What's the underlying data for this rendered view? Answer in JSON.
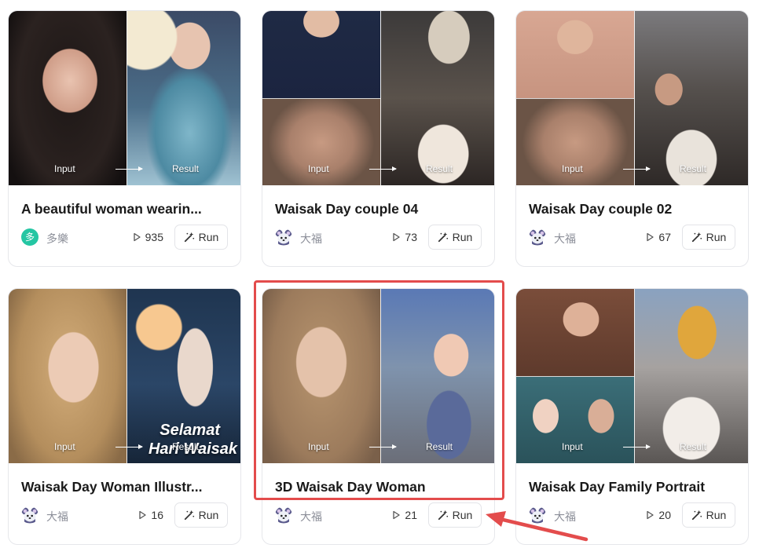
{
  "labels": {
    "input": "Input",
    "result": "Result",
    "run": "Run"
  },
  "colors": {
    "highlight": "#e34c4c",
    "avatar_green": "#24c6a3"
  },
  "cards": [
    {
      "title": "A beautiful woman wearin...",
      "author": "多樂",
      "avatar_text": "多",
      "runs": "935"
    },
    {
      "title": "Waisak Day couple 04",
      "author": "大福",
      "runs": "73"
    },
    {
      "title": "Waisak Day couple 02",
      "author": "大福",
      "runs": "67"
    },
    {
      "title": "Waisak Day Woman Illustr...",
      "author": "大福",
      "runs": "16",
      "overlay_line1": "Selamat",
      "overlay_line2": "Hari Waisak"
    },
    {
      "title": "3D Waisak Day Woman",
      "author": "大福",
      "runs": "21"
    },
    {
      "title": "Waisak Day Family Portrait",
      "author": "大福",
      "runs": "20"
    }
  ],
  "icons": {
    "play": "play-icon",
    "run": "magic-wand-icon",
    "avatar": "mouse-avatar-icon"
  }
}
